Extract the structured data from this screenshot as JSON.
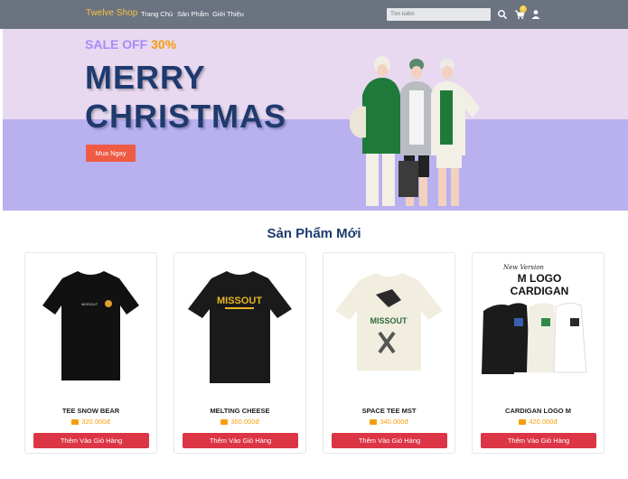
{
  "navbar": {
    "brand": "Twelve Shop",
    "links": [
      "Trang Chủ",
      "Sản Phẩm",
      "Giới Thiệu"
    ],
    "search_placeholder": "Tìm kiếm",
    "cart_count": "0",
    "icons": [
      "search-icon",
      "cart-icon",
      "user-icon"
    ]
  },
  "hero": {
    "sale_prefix": "SALE OFF",
    "sale_percent": "30%",
    "headline_line1": "MERRY",
    "headline_line2": "CHRISTMAS",
    "cta_label": "Mua Ngay"
  },
  "section_title": "Sản Phẩm Mới",
  "products": [
    {
      "name": "TEE SNOW BEAR",
      "price": "320.000đ",
      "button": "Thêm Vào Giỏ Hàng",
      "print": "MISSOUT"
    },
    {
      "name": "MELTING CHEESE",
      "price": "350.000đ",
      "button": "Thêm Vào Giỏ Hàng",
      "print": "MISSOUT"
    },
    {
      "name": "SPACE TEE MST",
      "price": "340.000đ",
      "button": "Thêm Vào Giỏ Hàng",
      "print": "MISSOUT"
    },
    {
      "name": "CARDIGAN LOGO M",
      "price": "420.000đ",
      "button": "Thêm Vào Giỏ Hàng",
      "print_line1": "New Version",
      "print_line2": "M LOGO",
      "print_line3": "CARDIGAN"
    }
  ],
  "colors": {
    "navbar_bg": "#6b7280",
    "brand": "#f5c542",
    "hero_top": "#e8d8f0",
    "hero_bottom": "#b8b0ef",
    "headline": "#1e3a6e",
    "cta": "#ef5b45",
    "price": "#f59e0b",
    "add_button": "#dc3545"
  }
}
